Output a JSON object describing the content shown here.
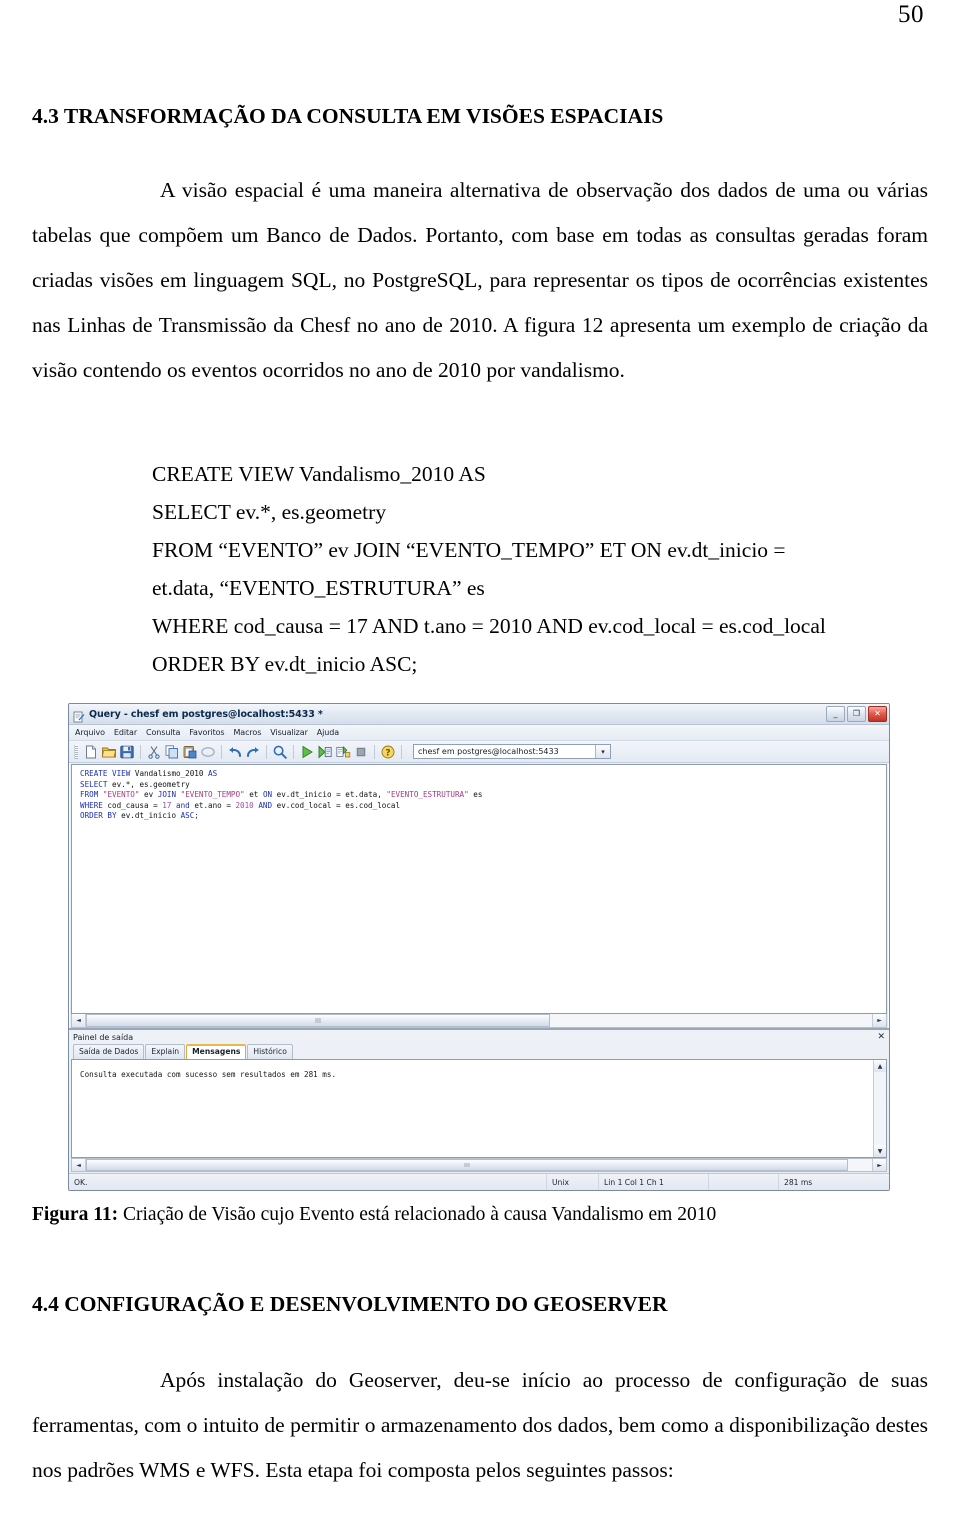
{
  "document": {
    "page_number": "50",
    "heading_43": "4.3 TRANSFORMAÇÃO DA CONSULTA EM VISÕES ESPACIAIS",
    "paragraph_1": "A visão espacial é uma maneira alternativa de observação dos dados de uma ou várias tabelas que compõem um Banco de Dados. Portanto, com base em todas as consultas geradas foram criadas visões em linguagem SQL, no PostgreSQL, para representar os tipos de ocorrências existentes nas Linhas de Transmissão da Chesf no ano de 2010. A figura 12 apresenta um exemplo de criação da visão contendo os eventos ocorridos no ano de 2010 por vandalismo.",
    "heading_44": "4.4 CONFIGURAÇÃO E DESENVOLVIMENTO DO GEOSERVER",
    "paragraph_2": "Após instalação do Geoserver, deu-se início ao processo de configuração de suas ferramentas, com o intuito de permitir o armazenamento dos dados, bem como a disponibilização destes nos padrões WMS e WFS. Esta etapa foi composta pelos seguintes passos:",
    "figure_caption_label": "Figura 11:",
    "figure_caption_text": " Criação de Visão cujo Evento está relacionado à causa Vandalismo em 2010"
  },
  "sql_listing": {
    "line_1": "CREATE VIEW Vandalismo_2010 AS",
    "line_2": "SELECT ev.*, es.geometry",
    "line_3": "FROM “EVENTO” ev JOIN “EVENTO_TEMPO” ET ON ev.dt_inicio =",
    "line_4": "et.data, “EVENTO_ESTRUTURA” es",
    "line_5": "WHERE cod_causa = 17 AND t.ano = 2010 AND ev.cod_local = es.cod_local",
    "line_6": "ORDER BY ev.dt_inicio ASC;"
  },
  "app_window": {
    "title": "Query - chesf em postgres@localhost:5433 *",
    "window_controls": {
      "minimize": "_",
      "maximize": "❐",
      "close": "✕"
    },
    "menu": [
      {
        "label": "Arquivo"
      },
      {
        "label": "Editar"
      },
      {
        "label": "Consulta"
      },
      {
        "label": "Favoritos"
      },
      {
        "label": "Macros"
      },
      {
        "label": "Visualizar"
      },
      {
        "label": "Ajuda"
      }
    ],
    "toolbar_icons": [
      "new-file-icon",
      "open-folder-icon",
      "save-disk-icon",
      "cut-scissors-icon",
      "copy-icon",
      "paste-icon",
      "clear-ellipse-icon",
      "undo-icon",
      "redo-icon",
      "find-magnifier-icon",
      "execute-play-icon",
      "execute-to-file-icon",
      "explain-analyze-icon",
      "stop-square-icon",
      "help-question-icon"
    ],
    "connection_combo": {
      "value": "chesf em postgres@localhost:5433",
      "arrow": "▾"
    },
    "editor": {
      "code_line_1_kw": "CREATE VIEW",
      "code_line_1_rest": " Vandalismo_2010 ",
      "code_line_1_as": "AS",
      "code_line_2_kw": "SELECT",
      "code_line_2_rest": " ev.*, es.geometry",
      "code_line_3_kw": "FROM",
      "code_line_3_s1": "\"EVENTO\"",
      "code_line_3_t1": " ev ",
      "code_line_3_kw2": "JOIN",
      "code_line_3_s2": "\"EVENTO_TEMPO\"",
      "code_line_3_t2": " et ",
      "code_line_3_kw3": "ON",
      "code_line_3_t3": " ev.dt_inicio = et.data, ",
      "code_line_3_s3": "\"EVENTO_ESTRUTURA\"",
      "code_line_3_t4": " es",
      "code_line_4_kw": "WHERE",
      "code_line_4_t1": " cod_causa = ",
      "code_line_4_n1": "17",
      "code_line_4_kw2": " and ",
      "code_line_4_t2": "et.ano = ",
      "code_line_4_n2": "2010",
      "code_line_4_kw3": " AND ",
      "code_line_4_t3": "ev.cod_local = es.cod_local",
      "code_line_5_kw": "ORDER BY",
      "code_line_5_rest": " ev.dt_inicio ",
      "code_line_5_asc": "ASC;"
    },
    "output_panel": {
      "title": "Painel de saída",
      "close_label": "✕",
      "tabs": [
        {
          "label": "Saída de Dados",
          "active": false
        },
        {
          "label": "Explain",
          "active": false
        },
        {
          "label": "Mensagens",
          "active": true
        },
        {
          "label": "Histórico",
          "active": false
        }
      ],
      "message": "Consulta executada com sucesso sem resultados em 281 ms."
    },
    "status_bar": {
      "status": "OK.",
      "line_ending": "Unix",
      "position": "Lin 1 Col 1 Ch 1",
      "spacer": "",
      "duration": "281 ms"
    },
    "scrollbars": {
      "left_arrow": "◄",
      "right_arrow": "►",
      "up_arrow": "▲",
      "down_arrow": "▼"
    }
  },
  "colors": {
    "sql_keyword": "#1c2fb0",
    "sql_string": "#a33a86",
    "sql_number": "#9a4ea8",
    "tab_active_accent": "#e8b94f",
    "close_button": "#c0352a",
    "window_border": "#7a8aa0"
  }
}
